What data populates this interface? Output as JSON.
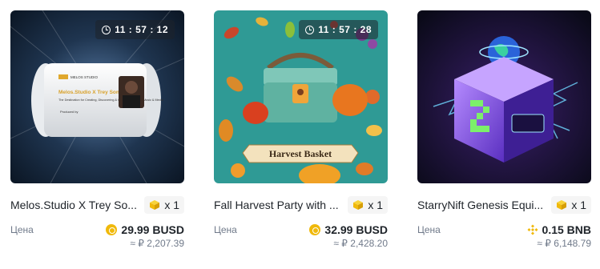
{
  "cards": [
    {
      "title": "Melos.Studio X Trey So...",
      "timer": "11 : 57 : 12",
      "quantity": "x 1",
      "price_label": "Цена",
      "price": "29.99 BUSD",
      "fiat": "≈ ₽ 2,207.39",
      "art_text": {
        "brand": "MELOS STUDIO",
        "headline": "Melos.Studio X Trey Songz",
        "tagline": "The Destination for Creating, Discovering & Collecting Original Music & Media",
        "produced": "Produced by"
      }
    },
    {
      "title": "Fall Harvest Party with ...",
      "timer": "11 : 57 : 28",
      "quantity": "x 1",
      "price_label": "Цена",
      "price": "32.99 BUSD",
      "fiat": "≈ ₽ 2,428.20",
      "art_text": {
        "banner": "Harvest Basket"
      }
    },
    {
      "title": "StarryNift Genesis Equi...",
      "quantity": "x 1",
      "price_label": "Цена",
      "price": "0.15 BNB",
      "fiat": "≈ ₽ 6,148.79"
    }
  ],
  "colors": {
    "accent": "#f0b90b",
    "text": "#1e2329",
    "muted": "#707a8a"
  }
}
